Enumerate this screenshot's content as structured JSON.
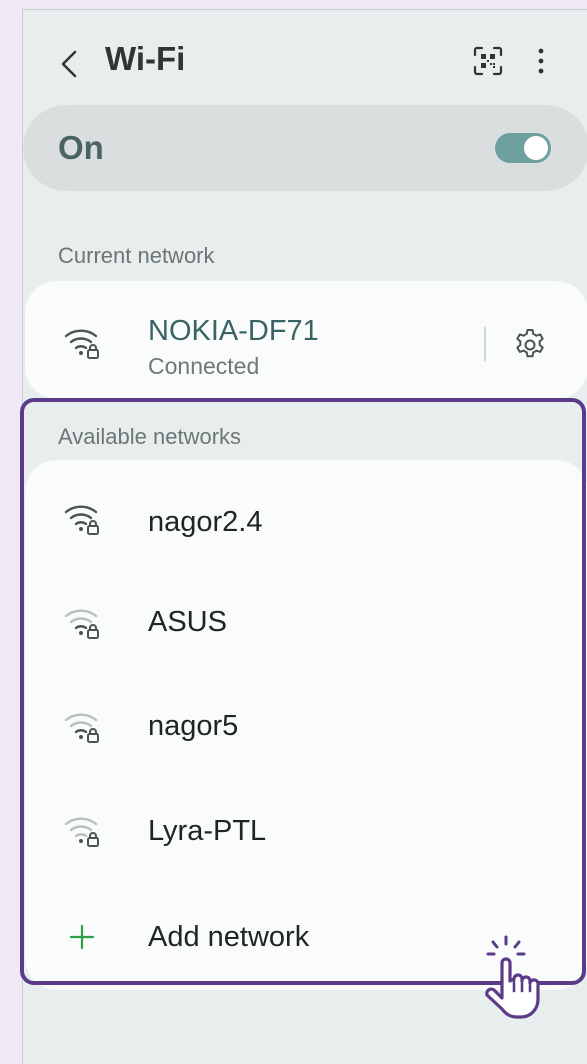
{
  "header": {
    "title": "Wi-Fi"
  },
  "wifi_toggle": {
    "label": "On",
    "state": "on"
  },
  "current_section": {
    "label": "Current network"
  },
  "current_network": {
    "name": "NOKIA-DF71",
    "status": "Connected"
  },
  "available_section": {
    "label": "Available networks"
  },
  "available_networks": [
    {
      "name": "nagor2.4",
      "signal": "strong"
    },
    {
      "name": "ASUS",
      "signal": "weak"
    },
    {
      "name": "nagor5",
      "signal": "weak"
    },
    {
      "name": "Lyra-PTL",
      "signal": "weak"
    }
  ],
  "add_network": {
    "label": "Add network"
  },
  "colors": {
    "accent": "#5b3a8a",
    "toggle_on": "#6fa0a0",
    "plus": "#2aa04a"
  },
  "icons": [
    "back-icon",
    "qr-scan-icon",
    "more-options-icon",
    "wifi-lock-icon",
    "gear-icon",
    "plus-icon",
    "tap-hand-icon"
  ]
}
